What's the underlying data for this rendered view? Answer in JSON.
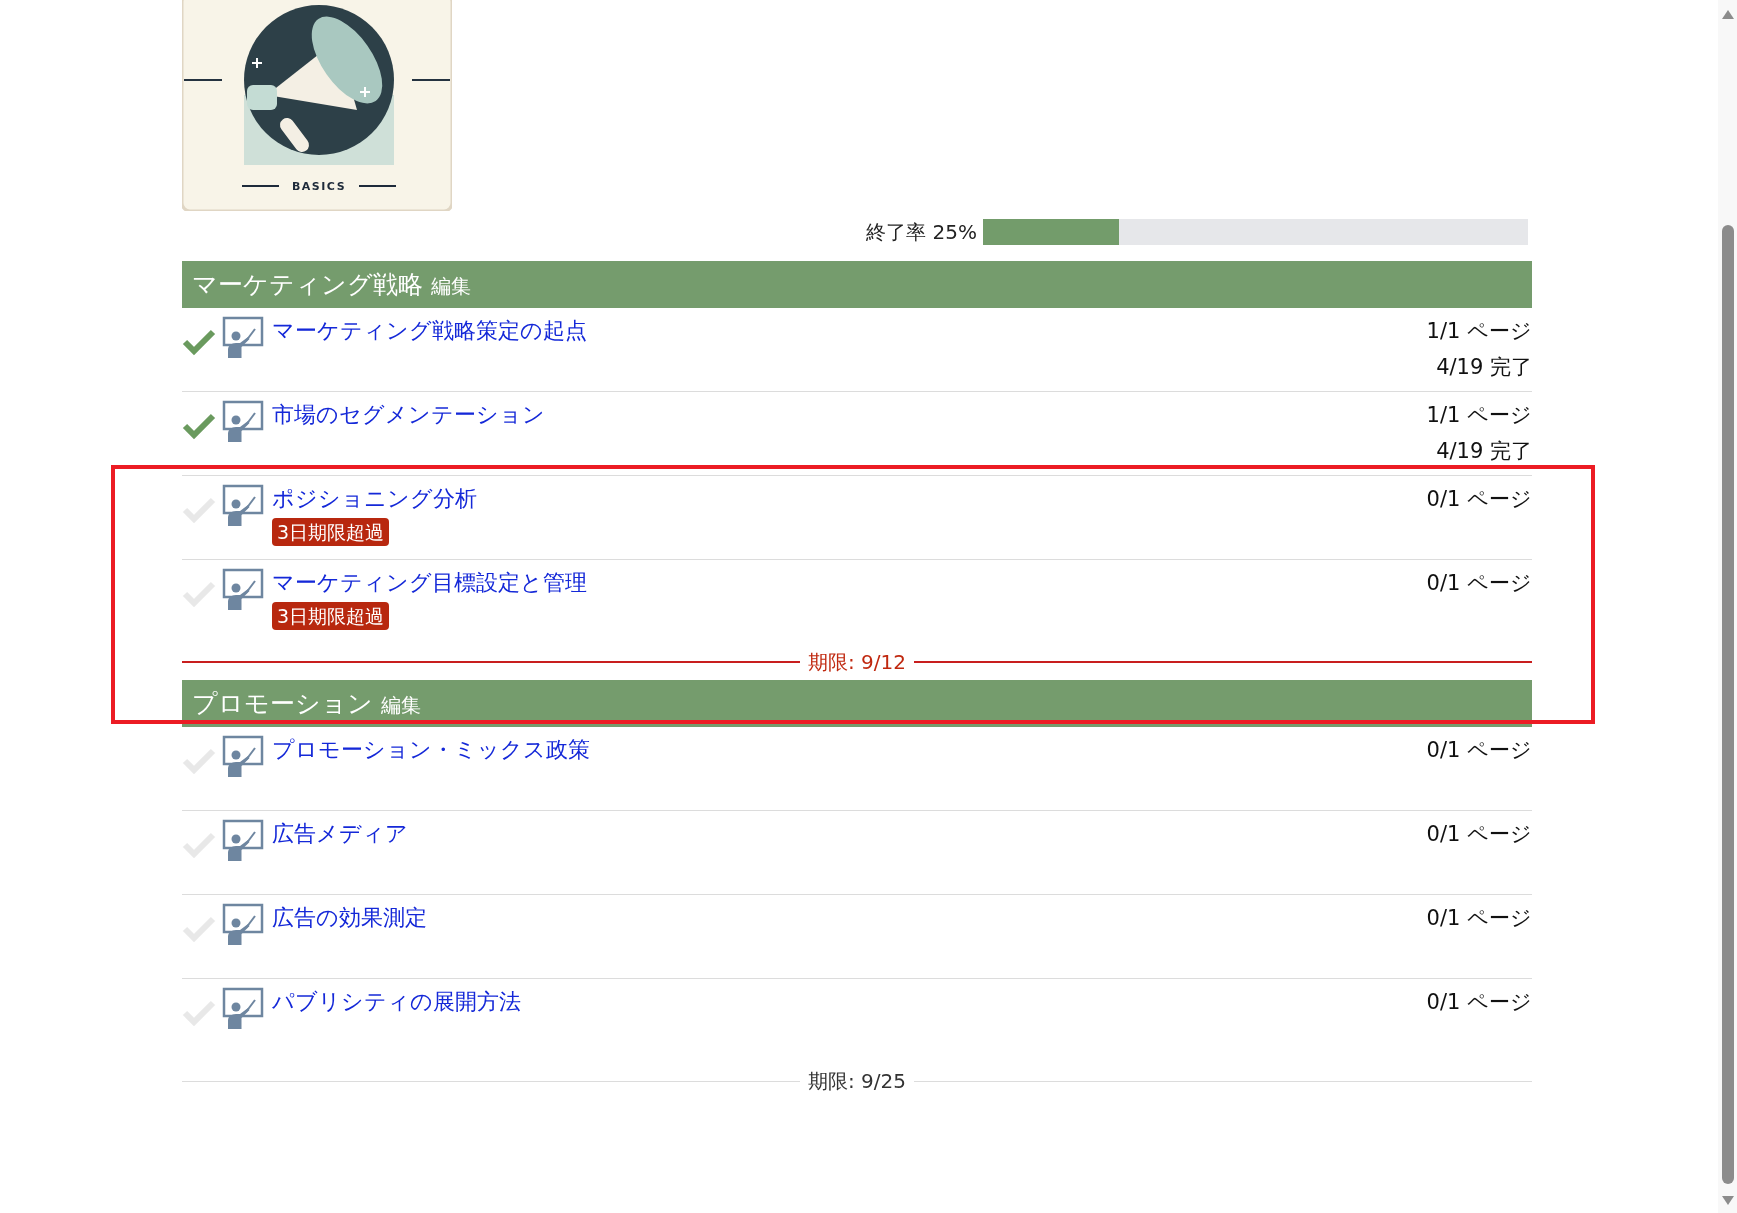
{
  "course_image": {
    "caption": "BASICS"
  },
  "progress": {
    "label": "終了率 25%",
    "level": 0.25
  },
  "sections": [
    {
      "title": "マーケティング戦略",
      "edit_link": "編集",
      "lessons": [
        {
          "title": "マーケティング戦略策定の起点",
          "completed": true,
          "pages": "1/1 ページ",
          "completed_date": "4/19 完了"
        },
        {
          "title": "市場のセグメンテーション",
          "completed": true,
          "pages": "1/1 ページ",
          "completed_date": "4/19 完了"
        },
        {
          "title": "ポジショニング分析",
          "completed": false,
          "pages": "0/1 ページ",
          "overdue_badge": "3日期限超過"
        },
        {
          "title": "マーケティング目標設定と管理",
          "completed": false,
          "pages": "0/1 ページ",
          "overdue_badge": "3日期限超過"
        }
      ],
      "deadline": {
        "text": "期限: 9/12",
        "overdue": true
      }
    },
    {
      "title": "プロモーション",
      "edit_link": "編集",
      "lessons": [
        {
          "title": "プロモーション・ミックス政策",
          "completed": false,
          "pages": "0/1 ページ"
        },
        {
          "title": "広告メディア",
          "completed": false,
          "pages": "0/1 ページ"
        },
        {
          "title": "広告の効果測定",
          "completed": false,
          "pages": "0/1 ページ"
        },
        {
          "title": "パブリシティの展開方法",
          "completed": false,
          "pages": "0/1 ページ"
        }
      ],
      "deadline": {
        "text": "期限: 9/25",
        "overdue": false
      }
    }
  ],
  "annotations": [
    {
      "kind": "rectangle"
    }
  ]
}
